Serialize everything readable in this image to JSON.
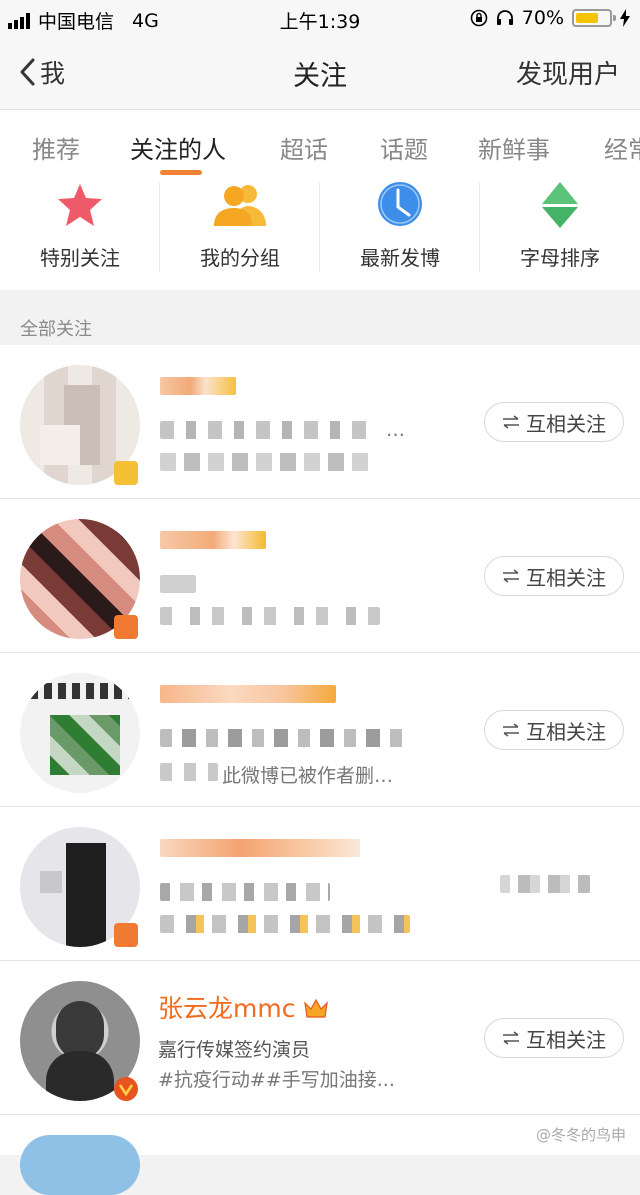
{
  "status": {
    "carrier": "中国电信",
    "network": "4G",
    "time": "上午1:39",
    "battery": "70%",
    "battery_fraction": 0.7
  },
  "nav": {
    "back_label": "我",
    "title": "关注",
    "right_label": "发现用户"
  },
  "tabs": [
    {
      "label": "推荐"
    },
    {
      "label": "关注的人"
    },
    {
      "label": "超话"
    },
    {
      "label": "话题"
    },
    {
      "label": "新鲜事"
    },
    {
      "label": "经常"
    }
  ],
  "groups": [
    {
      "label": "特别关注",
      "icon": "star-icon"
    },
    {
      "label": "我的分组",
      "icon": "people-icon"
    },
    {
      "label": "最新发博",
      "icon": "clock-icon"
    },
    {
      "label": "字母排序",
      "icon": "sort-icon"
    }
  ],
  "section_title": "全部关注",
  "rows": [
    {
      "follow_label": "互相关注",
      "snippet": "…"
    },
    {
      "follow_label": "互相关注"
    },
    {
      "follow_label": "互相关注",
      "snippet": "此微博已被作者删…"
    },
    {
      "follow_label": ""
    },
    {
      "name": "张云龙mmc",
      "desc": "嘉行传媒签约演员",
      "sub": "#抗疫行动##手写加油接...",
      "follow_label": "互相关注"
    }
  ],
  "watermark": "@冬冬的鸟申",
  "colors": {
    "accent": "#f08232",
    "name": "#f26b1d"
  }
}
